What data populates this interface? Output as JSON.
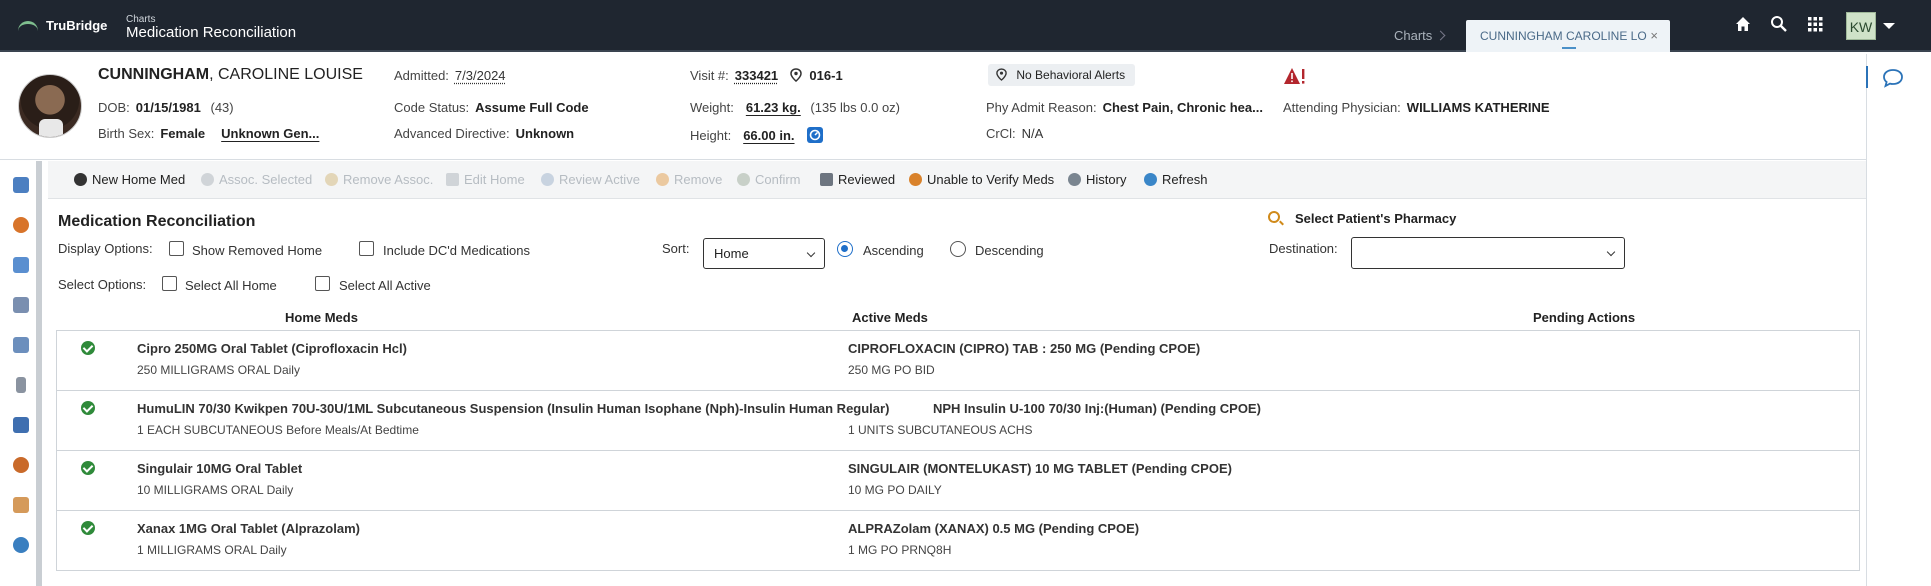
{
  "topbar": {
    "brand": "TruBridge",
    "breadcrumb_parent": "Charts",
    "breadcrumb_title": "Medication Reconciliation",
    "tab_charts": "Charts",
    "tab_active": "CUNNINGHAM CAROLINE LO",
    "tab_close": "×",
    "icons": [
      "home-icon",
      "search-icon",
      "apps-grid-icon"
    ],
    "user_initials": "KW"
  },
  "patient": {
    "last_name": "CUNNINGHAM",
    "first_names": ", CAROLINE LOUISE",
    "dob_label": "DOB:",
    "dob": "01/15/1981",
    "age": "(43)",
    "birth_sex_label": "Birth Sex:",
    "birth_sex": "Female",
    "gender": "Unknown Gen...",
    "admitted_label": "Admitted:",
    "admitted": "7/3/2024",
    "code_status_label": "Code Status:",
    "code_status": "Assume Full Code",
    "adv_directive_label": "Advanced Directive:",
    "adv_directive": "Unknown",
    "visit_label": "Visit #:",
    "visit": "333421",
    "room": "016-1",
    "weight_label": "Weight:",
    "weight": "61.23 kg.",
    "weight_lbs": "(135 lbs 0.0 oz)",
    "height_label": "Height:",
    "height": "66.00 in.",
    "behavioral_alert": "No Behavioral Alerts",
    "admit_reason_label": "Phy Admit Reason:",
    "admit_reason": "Chest Pain, Chronic hea...",
    "crcl_label": "CrCl:",
    "crcl": "N/A",
    "attending_label": "Attending Physician:",
    "attending": "WILLIAMS KATHERINE"
  },
  "toolbar": {
    "new_home_med": "New Home Med",
    "assoc_selected": "Assoc. Selected",
    "remove_assoc": "Remove Assoc.",
    "edit_home": "Edit Home",
    "review_active": "Review Active",
    "remove": "Remove",
    "confirm": "Confirm",
    "reviewed": "Reviewed",
    "unable_verify": "Unable to Verify Meds",
    "history": "History",
    "refresh": "Refresh"
  },
  "main": {
    "title": "Medication Reconciliation",
    "display_options_label": "Display Options:",
    "show_removed_home": "Show Removed Home",
    "include_dc": "Include DC'd Medications",
    "sort_label": "Sort:",
    "sort_value": "Home",
    "ascending": "Ascending",
    "descending": "Descending",
    "select_options_label": "Select Options:",
    "select_all_home": "Select All Home",
    "select_all_active": "Select All Active",
    "pharmacy_label": "Select Patient's Pharmacy",
    "destination_label": "Destination:",
    "destination_value": "",
    "col_home": "Home Meds",
    "col_active": "Active Meds",
    "col_pending": "Pending Actions"
  },
  "meds": [
    {
      "home_name": "Cipro 250MG Oral Tablet (Ciprofloxacin Hcl)",
      "home_sig": "250 MILLIGRAMS ORAL Daily",
      "active_name": "CIPROFLOXACIN (CIPRO) TAB : 250 MG (Pending CPOE)",
      "active_sig": "250 MG PO BID"
    },
    {
      "home_name": "HumuLIN 70/30 Kwikpen 70U-30U/1ML Subcutaneous Suspension (Insulin Human Isophane (Nph)-Insulin Human Regular)",
      "home_sig": "1 EACH SUBCUTANEOUS Before Meals/At Bedtime",
      "active_name": "NPH Insulin U-100 70/30 Inj:(Human) (Pending CPOE)",
      "active_sig": "1 UNITS SUBCUTANEOUS ACHS"
    },
    {
      "home_name": "Singulair 10MG Oral Tablet",
      "home_sig": "10 MILLIGRAMS ORAL Daily",
      "active_name": "SINGULAIR (MONTELUKAST) 10 MG TABLET (Pending CPOE)",
      "active_sig": "10 MG PO DAILY"
    },
    {
      "home_name": "Xanax 1MG Oral Tablet (Alprazolam)",
      "home_sig": "1 MILLIGRAMS ORAL Daily",
      "active_name": "ALPRAZolam (XANAX) 0.5 MG (Pending CPOE)",
      "active_sig": "1 MG PO PRNQ8H"
    }
  ]
}
